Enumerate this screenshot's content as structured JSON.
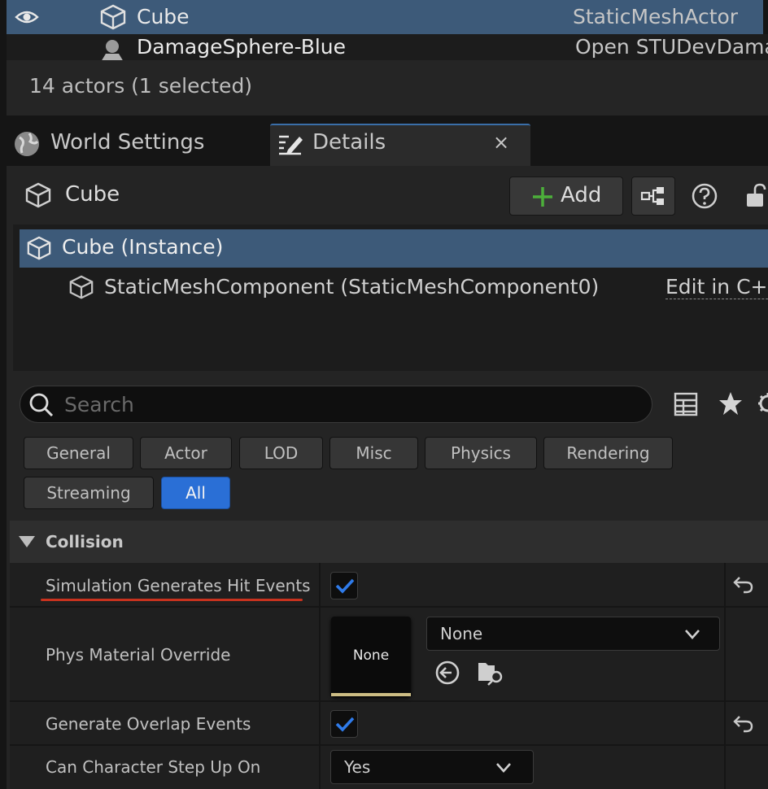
{
  "outliner": {
    "rows": [
      {
        "name": "Cube",
        "type": "StaticMeshActor",
        "selected": true,
        "visible_icon": "eye-icon"
      },
      {
        "name": "DamageSphere-Blue",
        "type": "Open STUDevDama"
      }
    ],
    "status": "14 actors (1 selected)"
  },
  "tabs": [
    {
      "label": "World Settings",
      "icon": "globe-icon"
    },
    {
      "label": "Details",
      "icon": "edit-icon",
      "active": true,
      "close": "×"
    }
  ],
  "details": {
    "actor_name": "Cube",
    "add_label": "Add",
    "components": [
      {
        "label": "Cube (Instance)",
        "selected": true
      },
      {
        "label": "StaticMeshComponent (StaticMeshComponent0)",
        "action": "Edit in C++"
      }
    ],
    "search_placeholder": "Search",
    "filters": [
      "General",
      "Actor",
      "LOD",
      "Misc",
      "Physics",
      "Rendering",
      "Streaming",
      "All"
    ],
    "active_filter": "All",
    "section": "Collision",
    "properties": {
      "hit_events": {
        "label": "Simulation Generates Hit Events",
        "checked": true
      },
      "phys_material": {
        "label": "Phys Material Override",
        "thumb": "None",
        "value": "None"
      },
      "overlap_events": {
        "label": "Generate Overlap Events",
        "checked": true
      },
      "step_up": {
        "label": "Can Character Step Up On",
        "value": "Yes"
      }
    }
  },
  "colors": {
    "selection": "#3d5a79",
    "accent": "#2a6fd6",
    "underline": "#c8321e",
    "add_plus": "#4caf3a"
  }
}
